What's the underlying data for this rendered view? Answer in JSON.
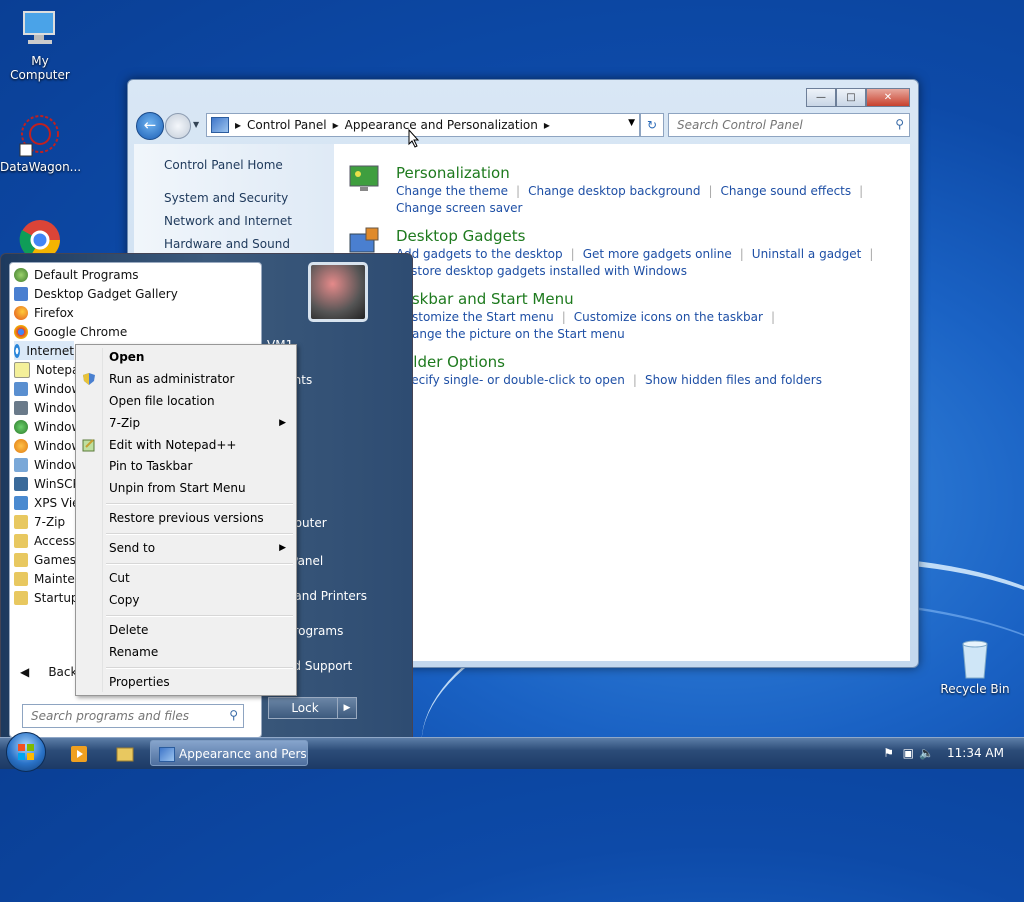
{
  "desktop": {
    "icons": [
      {
        "label": "My Computer"
      },
      {
        "label": "DataWagon..."
      },
      {
        "label": "Recycle Bin"
      }
    ]
  },
  "window": {
    "address": {
      "crumbs": [
        "Control Panel",
        "Appearance and Personalization"
      ]
    },
    "search_placeholder": "Search Control Panel",
    "left_pane": [
      "Control Panel Home",
      "System and Security",
      "Network and Internet",
      "Hardware and Sound"
    ],
    "categories": [
      {
        "title": "Personalization",
        "links": [
          "Change the theme",
          "Change desktop background",
          "Change sound effects",
          "Change screen saver"
        ]
      },
      {
        "title": "Desktop Gadgets",
        "links": [
          "Add gadgets to the desktop",
          "Get more gadgets online",
          "Uninstall a gadget",
          "Restore desktop gadgets installed with Windows"
        ]
      },
      {
        "title": "Taskbar and Start Menu",
        "links": [
          "Customize the Start menu",
          "Customize icons on the taskbar",
          "Change the picture on the Start menu"
        ]
      },
      {
        "title": "Folder Options",
        "links": [
          "Specify single- or double-click to open",
          "Show hidden files and folders"
        ]
      }
    ]
  },
  "start_menu": {
    "programs": [
      "Default Programs",
      "Desktop Gadget Gallery",
      "Firefox",
      "Google Chrome",
      "Internet",
      "Notepad",
      "Window",
      "Window",
      "Window",
      "Window",
      "Window",
      "WinSCP",
      "XPS View",
      "7-Zip",
      "Access",
      "Games",
      "Mainter",
      "Startup"
    ],
    "back_label": "Back",
    "search_placeholder": "Search programs and files",
    "right_items": [
      "VM1",
      "Documents",
      "Pictures",
      "Music",
      "Games",
      "Computer",
      "Control Panel",
      "Devices and Printers",
      "Default Programs",
      "Help and Support"
    ],
    "right_items_visible": [
      "VM1",
      "uments",
      "ures",
      "sic",
      "mes",
      "Computer",
      "trol Panel",
      "ices and Printers",
      "ult Programs",
      "p and Support"
    ],
    "lock_label": "Lock"
  },
  "context_menu": {
    "items": [
      "Open",
      "Run as administrator",
      "Open file location",
      "7-Zip",
      "Edit with Notepad++",
      "Pin to Taskbar",
      "Unpin from Start Menu",
      "Restore previous versions",
      "Send to",
      "Cut",
      "Copy",
      "Delete",
      "Rename",
      "Properties"
    ]
  },
  "taskbar": {
    "window_button": "Appearance and Pers...",
    "clock": "11:34 AM"
  }
}
